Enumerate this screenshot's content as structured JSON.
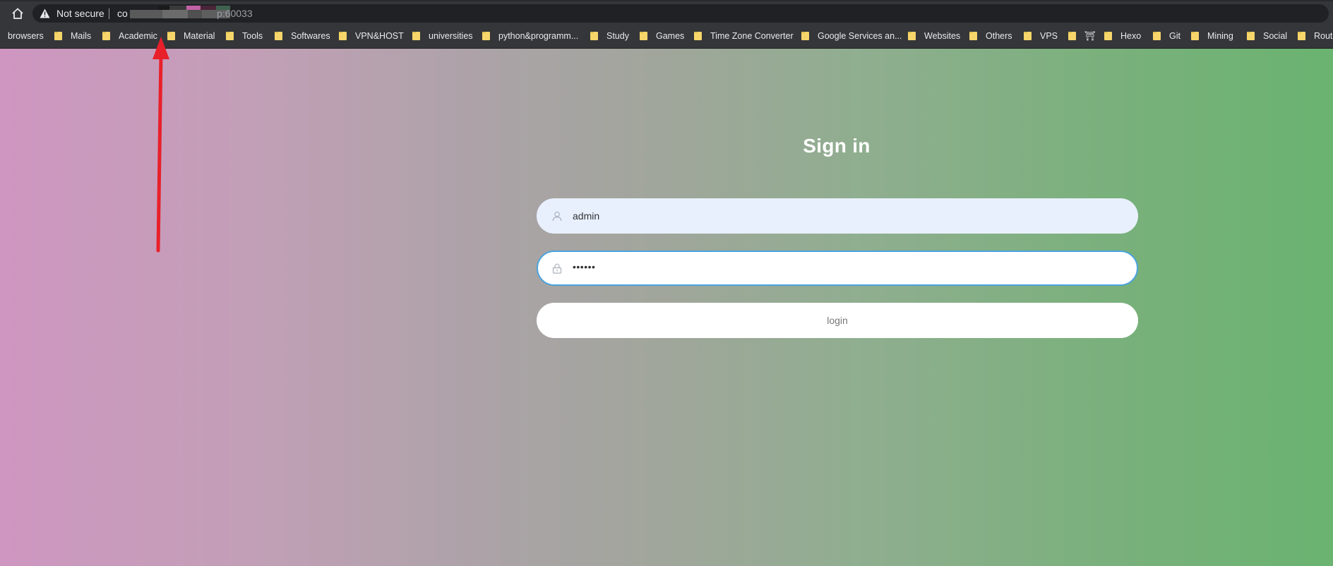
{
  "browser": {
    "security_label": "Not secure",
    "url_prefix": "co",
    "url_suffix": "p:60033",
    "bookmarks": [
      {
        "label": "browsers"
      },
      {
        "label": "Mails"
      },
      {
        "label": "Academic"
      },
      {
        "label": "Material"
      },
      {
        "label": "Tools"
      },
      {
        "label": "Softwares"
      },
      {
        "label": "VPN&HOST"
      },
      {
        "label": "universities"
      },
      {
        "label": "python&programm..."
      },
      {
        "label": "Study"
      },
      {
        "label": "Games"
      },
      {
        "label": "Time Zone Converter"
      },
      {
        "label": "Google Services an..."
      },
      {
        "label": "Websites"
      },
      {
        "label": "Others"
      },
      {
        "label": "VPS"
      },
      {
        "label": "⛩"
      },
      {
        "label": "Hexo"
      },
      {
        "label": "Git"
      },
      {
        "label": "Mining"
      },
      {
        "label": "Social"
      },
      {
        "label": "Route"
      }
    ]
  },
  "login": {
    "title": "Sign in",
    "username_value": "admin",
    "password_value": "••••••",
    "button_label": "login"
  },
  "colors": {
    "annotation_arrow": "#e8202a",
    "input_focus_border": "#4aa3df",
    "gradient_left": "#ce96c1",
    "gradient_right": "#6ab370"
  }
}
